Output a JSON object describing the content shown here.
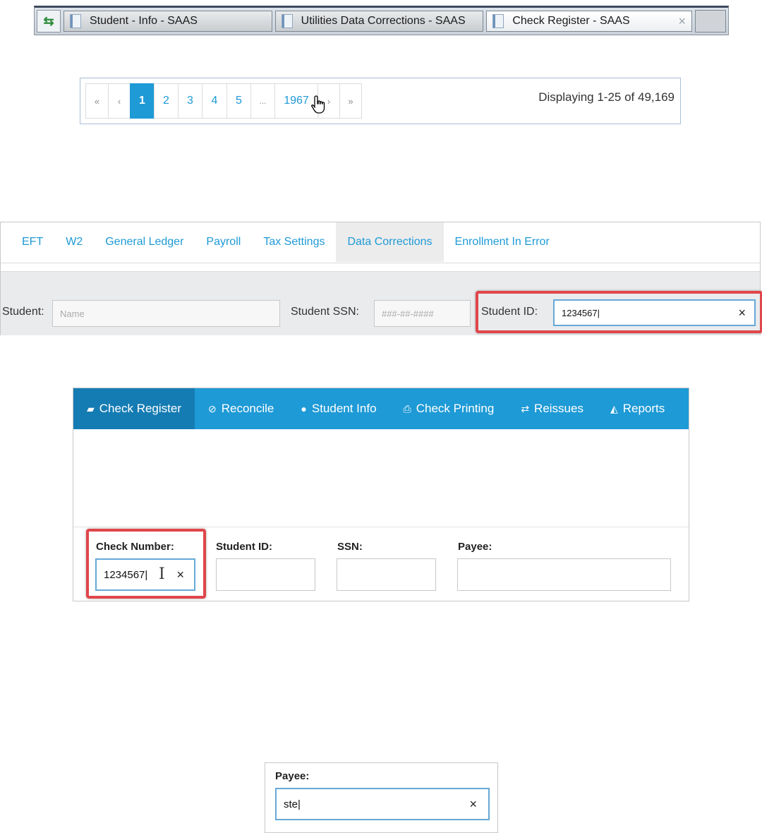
{
  "window_tabs": {
    "refresh_icon": "refresh-arrows-icon",
    "tabs": [
      {
        "label": "Student - Info - SAAS",
        "active": false
      },
      {
        "label": "Utilities Data Corrections - SAAS",
        "active": false
      },
      {
        "label": "Check Register - SAAS",
        "active": true
      }
    ],
    "close_glyph": "×"
  },
  "pagination": {
    "first": "«",
    "prev": "‹",
    "pages": [
      "1",
      "2",
      "3",
      "4",
      "5"
    ],
    "current_page": "1",
    "ellipsis": "...",
    "last_page": "1967",
    "next": "›",
    "last": "»",
    "summary": "Displaying 1-25 of 49,169"
  },
  "data_corrections": {
    "tabs": [
      {
        "label": "EFT",
        "active": false
      },
      {
        "label": "W2",
        "active": false
      },
      {
        "label": "General Ledger",
        "active": false
      },
      {
        "label": "Payroll",
        "active": false
      },
      {
        "label": "Tax Settings",
        "active": false
      },
      {
        "label": "Data Corrections",
        "active": true
      },
      {
        "label": "Enrollment In Error",
        "active": false
      }
    ],
    "filters": {
      "student_label": "Student:",
      "student_placeholder": "Name",
      "ssn_label": "Student SSN:",
      "ssn_placeholder": "###-##-####",
      "student_id_label": "Student ID:",
      "student_id_value": "1234567",
      "clear_glyph": "×"
    }
  },
  "check_register": {
    "tabs": [
      {
        "label": "Check Register",
        "icon": "book-icon",
        "glyph": "▰",
        "active": true
      },
      {
        "label": "Reconcile",
        "icon": "check-circle-icon",
        "glyph": "⊘",
        "active": false
      },
      {
        "label": "Student Info",
        "icon": "user-icon",
        "glyph": "●",
        "active": false
      },
      {
        "label": "Check Printing",
        "icon": "printer-icon",
        "glyph": "⎙",
        "active": false
      },
      {
        "label": "Reissues",
        "icon": "retweet-icon",
        "glyph": "⇄",
        "active": false
      },
      {
        "label": "Reports",
        "icon": "area-chart-icon",
        "glyph": "◭",
        "active": false
      }
    ],
    "fields": {
      "check_number_label": "Check Number:",
      "check_number_value": "1234567",
      "student_id_label": "Student ID:",
      "student_id_value": "",
      "ssn_label": "SSN:",
      "ssn_value": "",
      "payee_label": "Payee:",
      "payee_value": "",
      "clear_glyph": "×"
    }
  },
  "payee_filter": {
    "label": "Payee:",
    "value": "ste",
    "clear_glyph": "×"
  },
  "colors": {
    "accent_blue": "#1e9ad6",
    "highlight_red": "#e0464b",
    "focus_border": "#66a9d8"
  }
}
